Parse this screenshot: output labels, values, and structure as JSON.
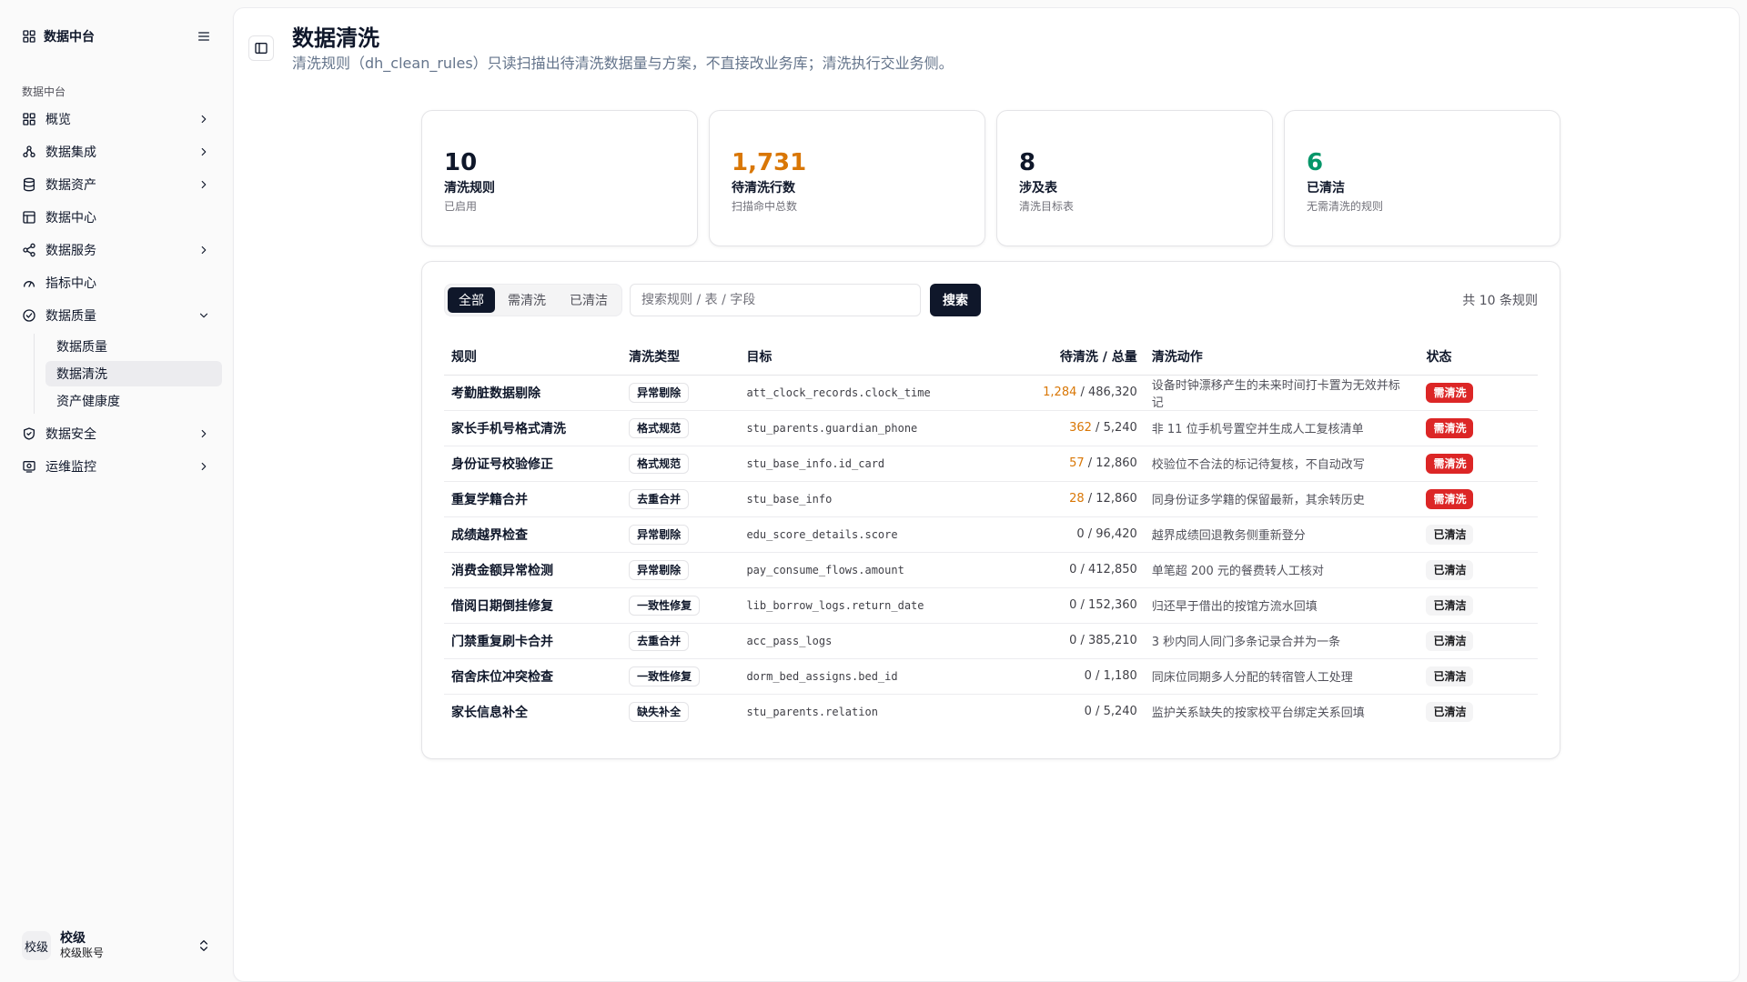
{
  "sidebar": {
    "brand": "数据中台",
    "group_label": "数据中台",
    "items": [
      {
        "label": "概览",
        "icon": "grid-icon",
        "chevron": "right"
      },
      {
        "label": "数据集成",
        "icon": "integration-icon",
        "chevron": "right"
      },
      {
        "label": "数据资产",
        "icon": "database-icon",
        "chevron": "right"
      },
      {
        "label": "数据中心",
        "icon": "table-icon",
        "chevron": ""
      },
      {
        "label": "数据服务",
        "icon": "share-icon",
        "chevron": "right"
      },
      {
        "label": "指标中心",
        "icon": "gauge-icon",
        "chevron": ""
      },
      {
        "label": "数据质量",
        "icon": "check-circle-icon",
        "chevron": "down",
        "children": [
          "数据质量",
          "数据清洗",
          "资产健康度"
        ],
        "active_child": 1
      },
      {
        "label": "数据安全",
        "icon": "shield-check-icon",
        "chevron": "right"
      },
      {
        "label": "运维监控",
        "icon": "monitor-icon",
        "chevron": "right"
      }
    ],
    "user": {
      "avatar": "校级",
      "name": "校级",
      "sub": "校级账号"
    }
  },
  "header": {
    "title": "数据清洗",
    "subtitle": "清洗规则（dh_clean_rules）只读扫描出待清洗数据量与方案，不直接改业务库；清洗执行交业务侧。"
  },
  "stats": [
    {
      "value": "10",
      "label": "清洗规则",
      "sub": "已启用",
      "color": "#0f172a"
    },
    {
      "value": "1,731",
      "label": "待清洗行数",
      "sub": "扫描命中总数",
      "color": "#d97706"
    },
    {
      "value": "8",
      "label": "涉及表",
      "sub": "清洗目标表",
      "color": "#0f172a"
    },
    {
      "value": "6",
      "label": "已清洁",
      "sub": "无需清洗的规则",
      "color": "#059669"
    }
  ],
  "filters": {
    "tabs": [
      "全部",
      "需清洗",
      "已清洁"
    ],
    "active": 0
  },
  "search": {
    "placeholder": "搜索规则 / 表 / 字段",
    "value": "",
    "button": "搜索"
  },
  "total_text": "共 10 条规则",
  "table": {
    "columns": [
      "规则",
      "清洗类型",
      "目标",
      "待清洗 / 总量",
      "清洗动作",
      "状态"
    ],
    "rows": [
      {
        "rule": "考勤脏数据剔除",
        "type": "异常剔除",
        "target": "att_clock_records.clock_time",
        "pending": "1,284",
        "total": "486,320",
        "action": "设备时钟漂移产生的未来时间打卡置为无效并标记",
        "status": "需清洗",
        "need": true
      },
      {
        "rule": "家长手机号格式清洗",
        "type": "格式规范",
        "target": "stu_parents.guardian_phone",
        "pending": "362",
        "total": "5,240",
        "action": "非 11 位手机号置空并生成人工复核清单",
        "status": "需清洗",
        "need": true
      },
      {
        "rule": "身份证号校验修正",
        "type": "格式规范",
        "target": "stu_base_info.id_card",
        "pending": "57",
        "total": "12,860",
        "action": "校验位不合法的标记待复核，不自动改写",
        "status": "需清洗",
        "need": true
      },
      {
        "rule": "重复学籍合并",
        "type": "去重合并",
        "target": "stu_base_info",
        "pending": "28",
        "total": "12,860",
        "action": "同身份证多学籍的保留最新，其余转历史",
        "status": "需清洗",
        "need": true
      },
      {
        "rule": "成绩越界检查",
        "type": "异常剔除",
        "target": "edu_score_details.score",
        "pending": "0",
        "total": "96,420",
        "action": "越界成绩回退教务侧重新登分",
        "status": "已清洁",
        "need": false
      },
      {
        "rule": "消费金额异常检测",
        "type": "异常剔除",
        "target": "pay_consume_flows.amount",
        "pending": "0",
        "total": "412,850",
        "action": "单笔超 200 元的餐费转人工核对",
        "status": "已清洁",
        "need": false
      },
      {
        "rule": "借阅日期倒挂修复",
        "type": "一致性修复",
        "target": "lib_borrow_logs.return_date",
        "pending": "0",
        "total": "152,360",
        "action": "归还早于借出的按馆方流水回填",
        "status": "已清洁",
        "need": false
      },
      {
        "rule": "门禁重复刷卡合并",
        "type": "去重合并",
        "target": "acc_pass_logs",
        "pending": "0",
        "total": "385,210",
        "action": "3 秒内同人同门多条记录合并为一条",
        "status": "已清洁",
        "need": false
      },
      {
        "rule": "宿舍床位冲突检查",
        "type": "一致性修复",
        "target": "dorm_bed_assigns.bed_id",
        "pending": "0",
        "total": "1,180",
        "action": "同床位同期多人分配的转宿管人工处理",
        "status": "已清洁",
        "need": false
      },
      {
        "rule": "家长信息补全",
        "type": "缺失补全",
        "target": "stu_parents.relation",
        "pending": "0",
        "total": "5,240",
        "action": "监护关系缺失的按家校平台绑定关系回填",
        "status": "已清洁",
        "need": false
      }
    ]
  }
}
